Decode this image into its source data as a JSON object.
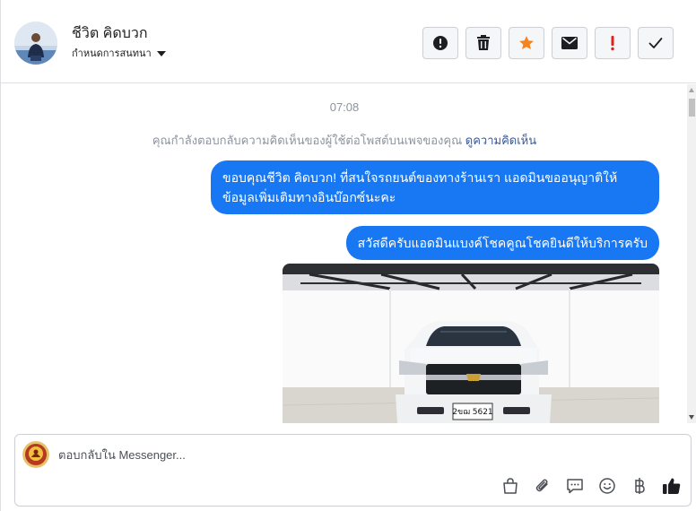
{
  "header": {
    "contact_name": "ชีวิต คิดบวก",
    "conversation_menu_label": "กำหนดการสนทนา"
  },
  "actions": [
    {
      "name": "report-icon",
      "color": "#1c1e21"
    },
    {
      "name": "trash-icon",
      "color": "#1c1e21"
    },
    {
      "name": "star-icon",
      "color": "#f5831f"
    },
    {
      "name": "envelope-icon",
      "color": "#1c1e21"
    },
    {
      "name": "exclamation-icon",
      "color": "#e02020"
    },
    {
      "name": "checkmark-icon",
      "color": "#1c1e21"
    }
  ],
  "conversation": {
    "timestamp": "07:08",
    "notice_text": "คุณกำลังตอบกลับความคิดเห็นของผู้ใช้ต่อโพสต์บนเพจของคุณ",
    "notice_link": "ดูความคิดเห็น",
    "messages": [
      {
        "text": "ขอบคุณชีวิต คิดบวก! ที่สนใจรถยนต์ของทางร้านเรา แอดมินขออนุญาติให้ข้อมูลเพิ่มเติมทางอินบ๊อกซ์นะคะ"
      },
      {
        "text": "สวัสดีครับแอดมินแบงค์โชคคูณโชคยินดีให้บริการครับ"
      }
    ],
    "photo": {
      "subject": "white-pickup-truck",
      "plate_text": "2ขฌ 5621"
    }
  },
  "composer": {
    "placeholder": "ตอบกลับใน Messenger..."
  },
  "tools": [
    "shopping-bag-icon",
    "paperclip-icon",
    "saved-reply-icon",
    "emoji-icon",
    "baht-icon",
    "thumbs-up-icon"
  ],
  "colors": {
    "accent": "#1877f2",
    "star": "#f5831f",
    "alert": "#e02020"
  }
}
